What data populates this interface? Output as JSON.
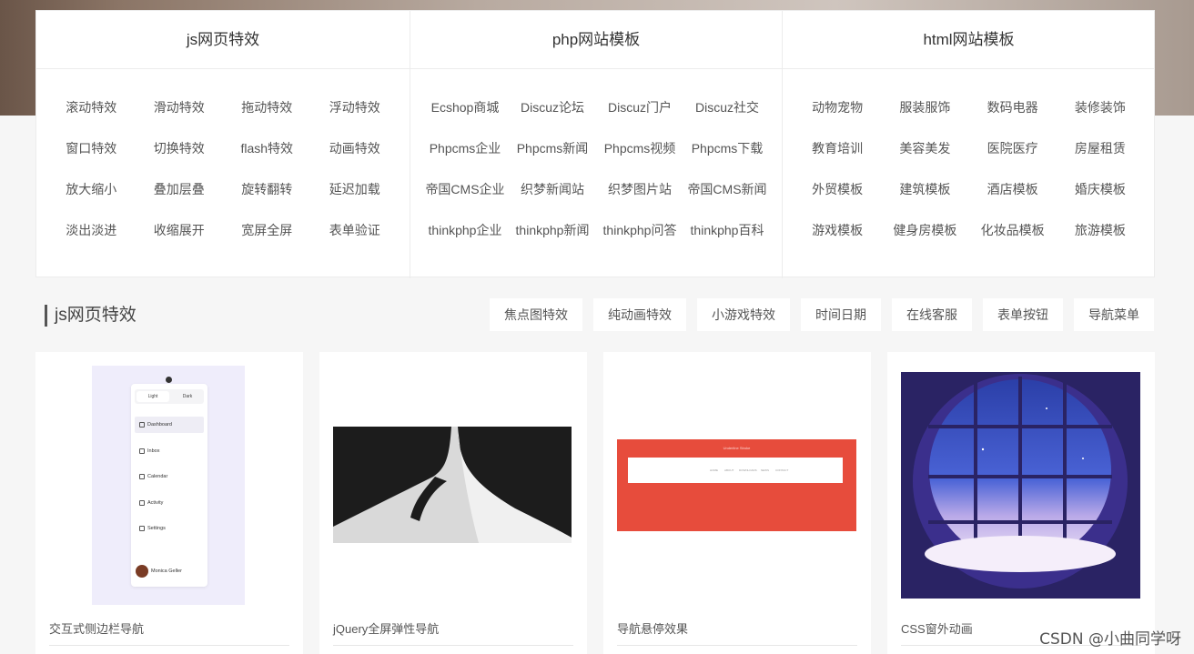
{
  "categories": [
    {
      "heading": "js网页特效",
      "links": [
        "滚动特效",
        "滑动特效",
        "拖动特效",
        "浮动特效",
        "窗口特效",
        "切换特效",
        "flash特效",
        "动画特效",
        "放大缩小",
        "叠加层叠",
        "旋转翻转",
        "延迟加载",
        "淡出淡进",
        "收缩展开",
        "宽屏全屏",
        "表单验证"
      ]
    },
    {
      "heading": "php网站模板",
      "links": [
        "Ecshop商城",
        "Discuz论坛",
        "Discuz门户",
        "Discuz社交",
        "Phpcms企业",
        "Phpcms新闻",
        "Phpcms视频",
        "Phpcms下载",
        "帝国CMS企业",
        "织梦新闻站",
        "织梦图片站",
        "帝国CMS新闻",
        "thinkphp企业",
        "thinkphp新闻",
        "thinkphp问答",
        "thinkphp百科"
      ]
    },
    {
      "heading": "html网站模板",
      "links": [
        "动物宠物",
        "服装服饰",
        "数码电器",
        "装修装饰",
        "教育培训",
        "美容美发",
        "医院医疗",
        "房屋租赁",
        "外贸模板",
        "建筑模板",
        "酒店模板",
        "婚庆模板",
        "游戏模板",
        "健身房模板",
        "化妆品模板",
        "旅游模板"
      ]
    }
  ],
  "section": {
    "title": "js网页特效",
    "tabs": [
      "焦点图特效",
      "纯动画特效",
      "小游戏特效",
      "时间日期",
      "在线客服",
      "表单按钮",
      "导航菜单"
    ]
  },
  "cards": [
    {
      "title": "交互式侧边栏导航"
    },
    {
      "title": "jQuery全屏弹性导航"
    },
    {
      "title": "导航悬停效果"
    },
    {
      "title": "CSS窗外动画"
    }
  ],
  "thumb_sidebar": {
    "mode_light": "Light",
    "mode_dark": "Dark",
    "menu": [
      "Dashboard",
      "Inbox",
      "Calendar",
      "Activity",
      "Settings"
    ],
    "user": "Monica Geller"
  },
  "thumb_hover": {
    "caption": "Underline Stroke",
    "items": [
      "HOME",
      "ABOUT",
      "DOWNLOADS",
      "NEWS",
      "CONTACT"
    ]
  },
  "watermark": "CSDN @小曲同学呀",
  "colors": {
    "page_bg": "#f6f6f6",
    "panel_bg": "#ffffff",
    "red_thumb": "#e74c3c",
    "window_thumb": "#2a2364"
  }
}
